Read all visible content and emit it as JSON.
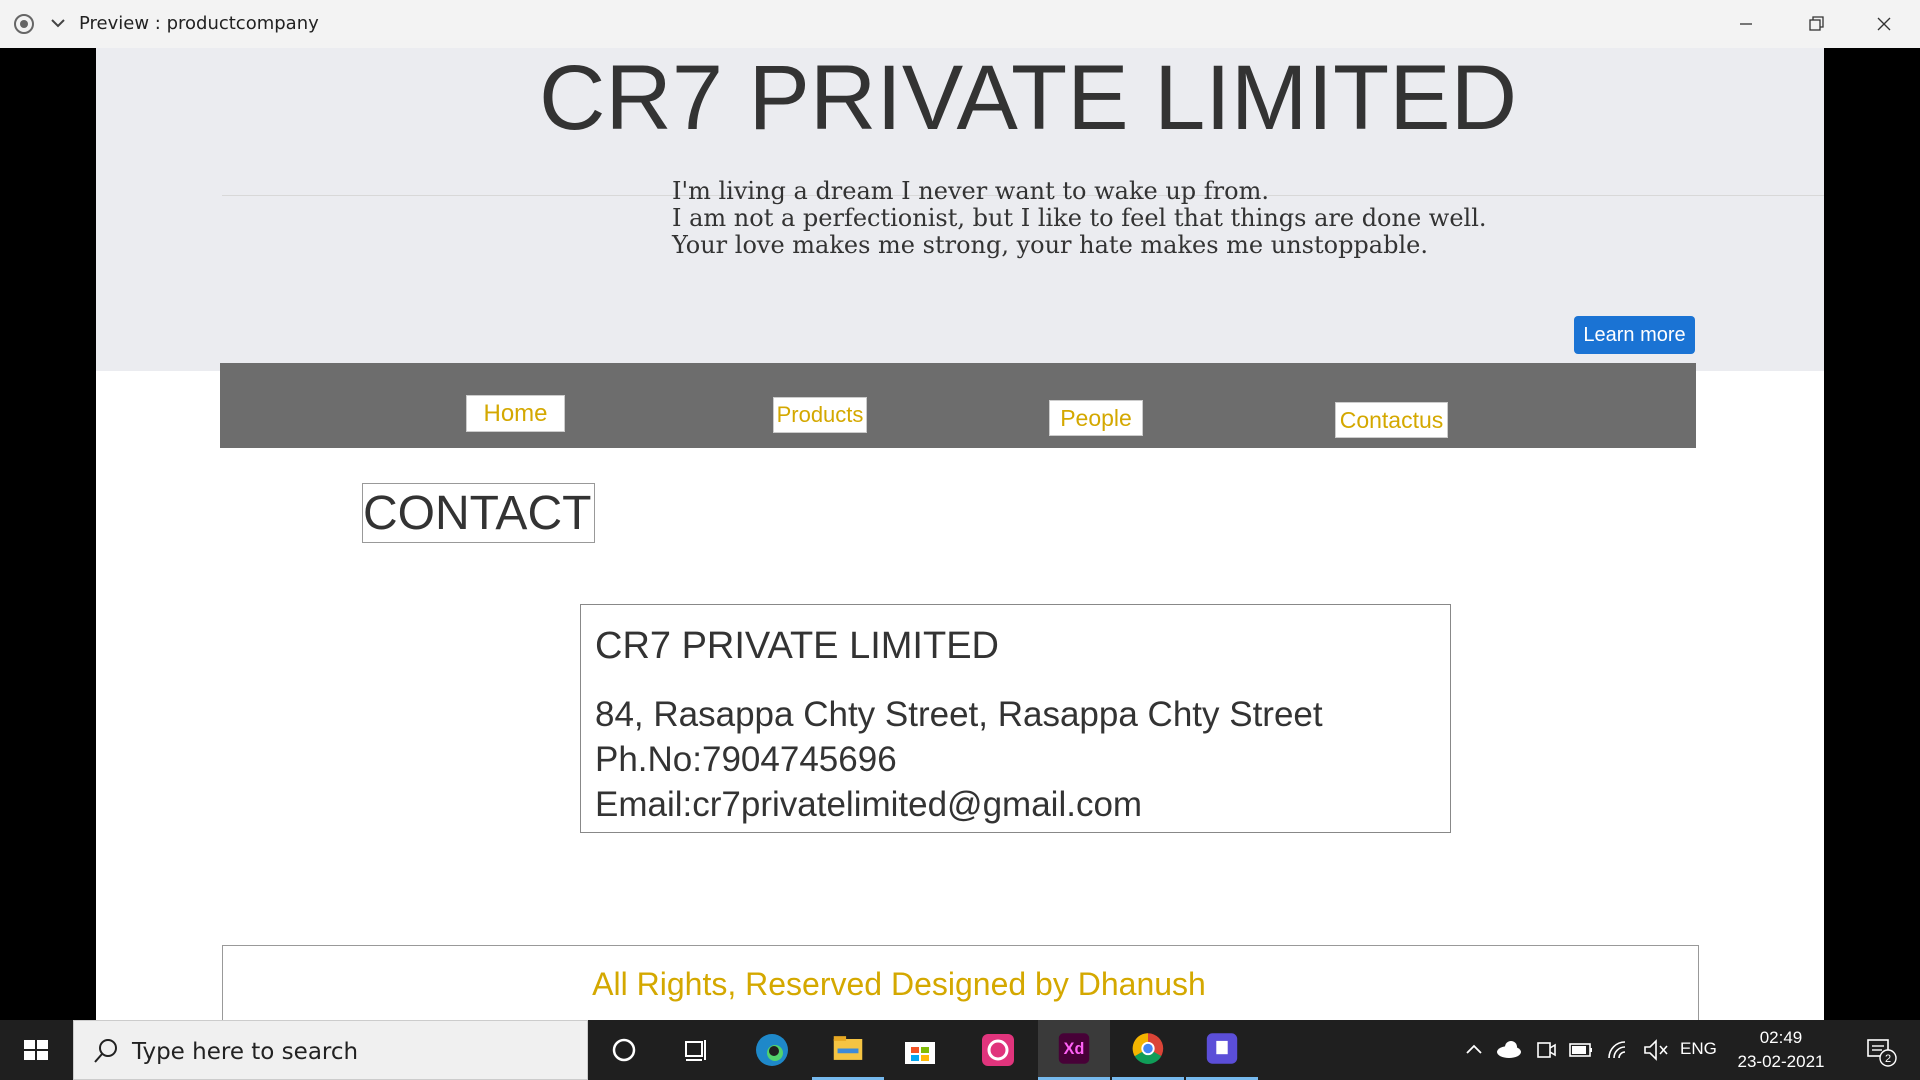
{
  "window": {
    "title": "Preview : productcompany"
  },
  "hero": {
    "company": "CR7 PRIVATE LIMITED",
    "quotes": [
      "I'm living a dream I never want to wake up from.",
      "I am not a perfectionist, but I like to feel that things are done well.",
      "Your love makes me strong, your hate makes me unstoppable."
    ],
    "learn_more": "Learn more"
  },
  "nav": {
    "home": "Home",
    "products": "Products",
    "people": "People",
    "contact": "Contactus"
  },
  "contact": {
    "heading": "CONTACT",
    "company": "CR7 PRIVATE LIMITED",
    "address": "84, Rasappa Chty Street, Rasappa Chty Street",
    "phone": "Ph.No:7904745696",
    "email": "Email:cr7privatelimited@gmail.com"
  },
  "footer": {
    "text": "All Rights, Reserved Designed by Dhanush"
  },
  "taskbar": {
    "search_placeholder": "Type here to search",
    "language": "ENG",
    "time": "02:49",
    "date": "23-02-2021",
    "notification_count": "2",
    "apps": [
      "cortana-icon",
      "task-view-icon",
      "edge-icon",
      "file-explorer-icon",
      "store-icon",
      "creative-cloud-icon",
      "adobe-xd-icon",
      "chrome-icon",
      "app-icon"
    ]
  },
  "colors": {
    "accent_blue": "#1a73d4",
    "nav_text_gold": "#d4a800",
    "nav_bar": "#6d6d6d",
    "hero_bg": "#ebecf0"
  }
}
